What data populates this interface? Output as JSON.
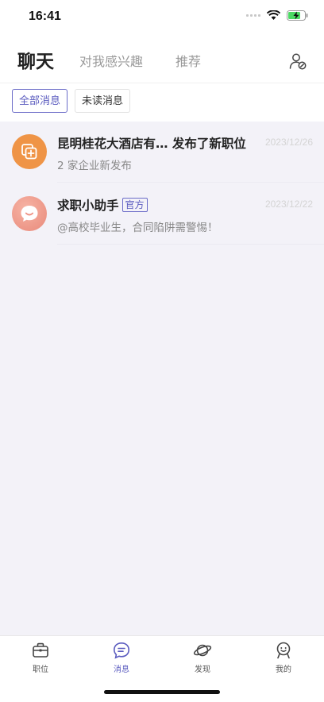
{
  "status_bar": {
    "time": "16:41"
  },
  "header": {
    "tabs": [
      {
        "label": "聊天",
        "active": true
      },
      {
        "label": "对我感兴趣",
        "active": false
      },
      {
        "label": "推荐",
        "active": false
      }
    ],
    "contacts_icon": "person-settings-icon"
  },
  "filters": {
    "all_label": "全部消息",
    "unread_label": "未读消息"
  },
  "messages": [
    {
      "title": "昆明桂花大酒店有…  发布了新职位",
      "preview": "2 家企业新发布",
      "date": "2023/12/26",
      "avatar_color": "#ef9446",
      "icon": "job-post-icon"
    },
    {
      "title": "求职小助手",
      "badge": "官方",
      "preview": "@高校毕业生，合同陷阱需警惕！",
      "date": "2023/12/22",
      "avatar_color": "#ee9a8a",
      "icon": "smile-chat-icon"
    }
  ],
  "tabbar": {
    "items": [
      {
        "label": "职位",
        "icon": "briefcase-icon",
        "active": false
      },
      {
        "label": "消息",
        "icon": "message-icon",
        "active": true
      },
      {
        "label": "发现",
        "icon": "planet-icon",
        "active": false
      },
      {
        "label": "我的",
        "icon": "profile-icon",
        "active": false
      }
    ]
  },
  "colors": {
    "accent": "#5a5bbf",
    "background": "#f3f2f8"
  }
}
